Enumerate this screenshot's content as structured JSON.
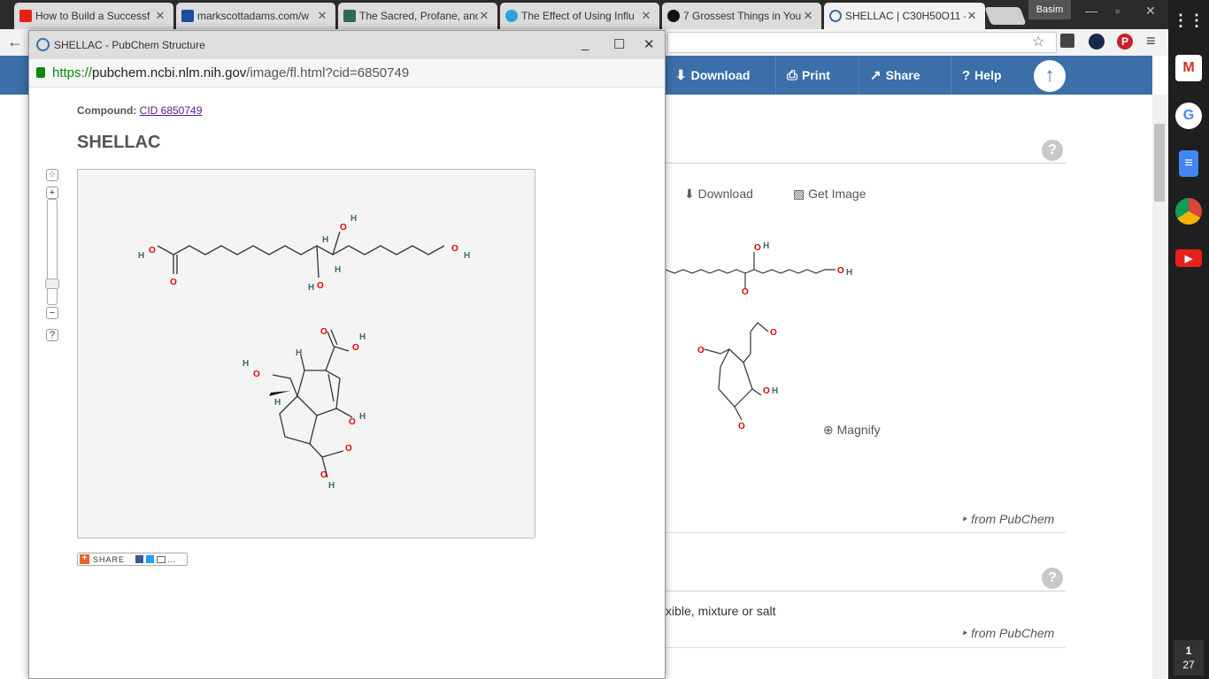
{
  "browser": {
    "tabs": [
      {
        "title": "How to Build a Successf",
        "favicon": "youtube-icon",
        "color": "#e62117"
      },
      {
        "title": "markscottadams.com/w",
        "favicon": "grid-icon",
        "color": "#1f4e9b"
      },
      {
        "title": "The Sacred, Profane, anc",
        "favicon": "h-icon",
        "color": "#2f6b4f"
      },
      {
        "title": "The Effect of Using Influ",
        "favicon": "circle-icon",
        "color": "#2aa4dc"
      },
      {
        "title": "7 Grossest Things in You",
        "favicon": "abc-icon",
        "color": "#111111"
      },
      {
        "title": "SHELLAC | C30H50O11 -",
        "favicon": "pubchem-icon",
        "color": "#3a6fa8"
      }
    ],
    "profile_name": "Basim",
    "clock": {
      "hour": "1",
      "minute": "27"
    }
  },
  "background_page": {
    "nav": [
      {
        "label": "Download",
        "icon": "download-icon"
      },
      {
        "label": "Print",
        "icon": "print-icon"
      },
      {
        "label": "Share",
        "icon": "share-icon"
      },
      {
        "label": "Help",
        "icon": "help-icon"
      }
    ],
    "download_link": "Download",
    "get_image_link": "Get Image",
    "magnify_link": "Magnify",
    "from_pubchem_1": "from PubChem",
    "from_pubchem_2": "from PubChem",
    "partial_text": "xible, mixture or salt"
  },
  "popup": {
    "window_title": "SHELLAC - PubChem Structure",
    "url_scheme": "https://",
    "url_host": "pubchem.ncbi.nlm.nih.gov",
    "url_path": "/image/fl.html?cid=6850749",
    "compound_label": "Compound:",
    "compound_link": "CID 6850749",
    "compound_name": "SHELLAC",
    "zoom_help": "?",
    "share_label": "SHARE",
    "atoms": {
      "H": "H",
      "O": "O"
    }
  },
  "colors": {
    "accent": "#3a6fa8",
    "oxygen": "#e00000",
    "hydrogen": "#3d6b6b"
  }
}
